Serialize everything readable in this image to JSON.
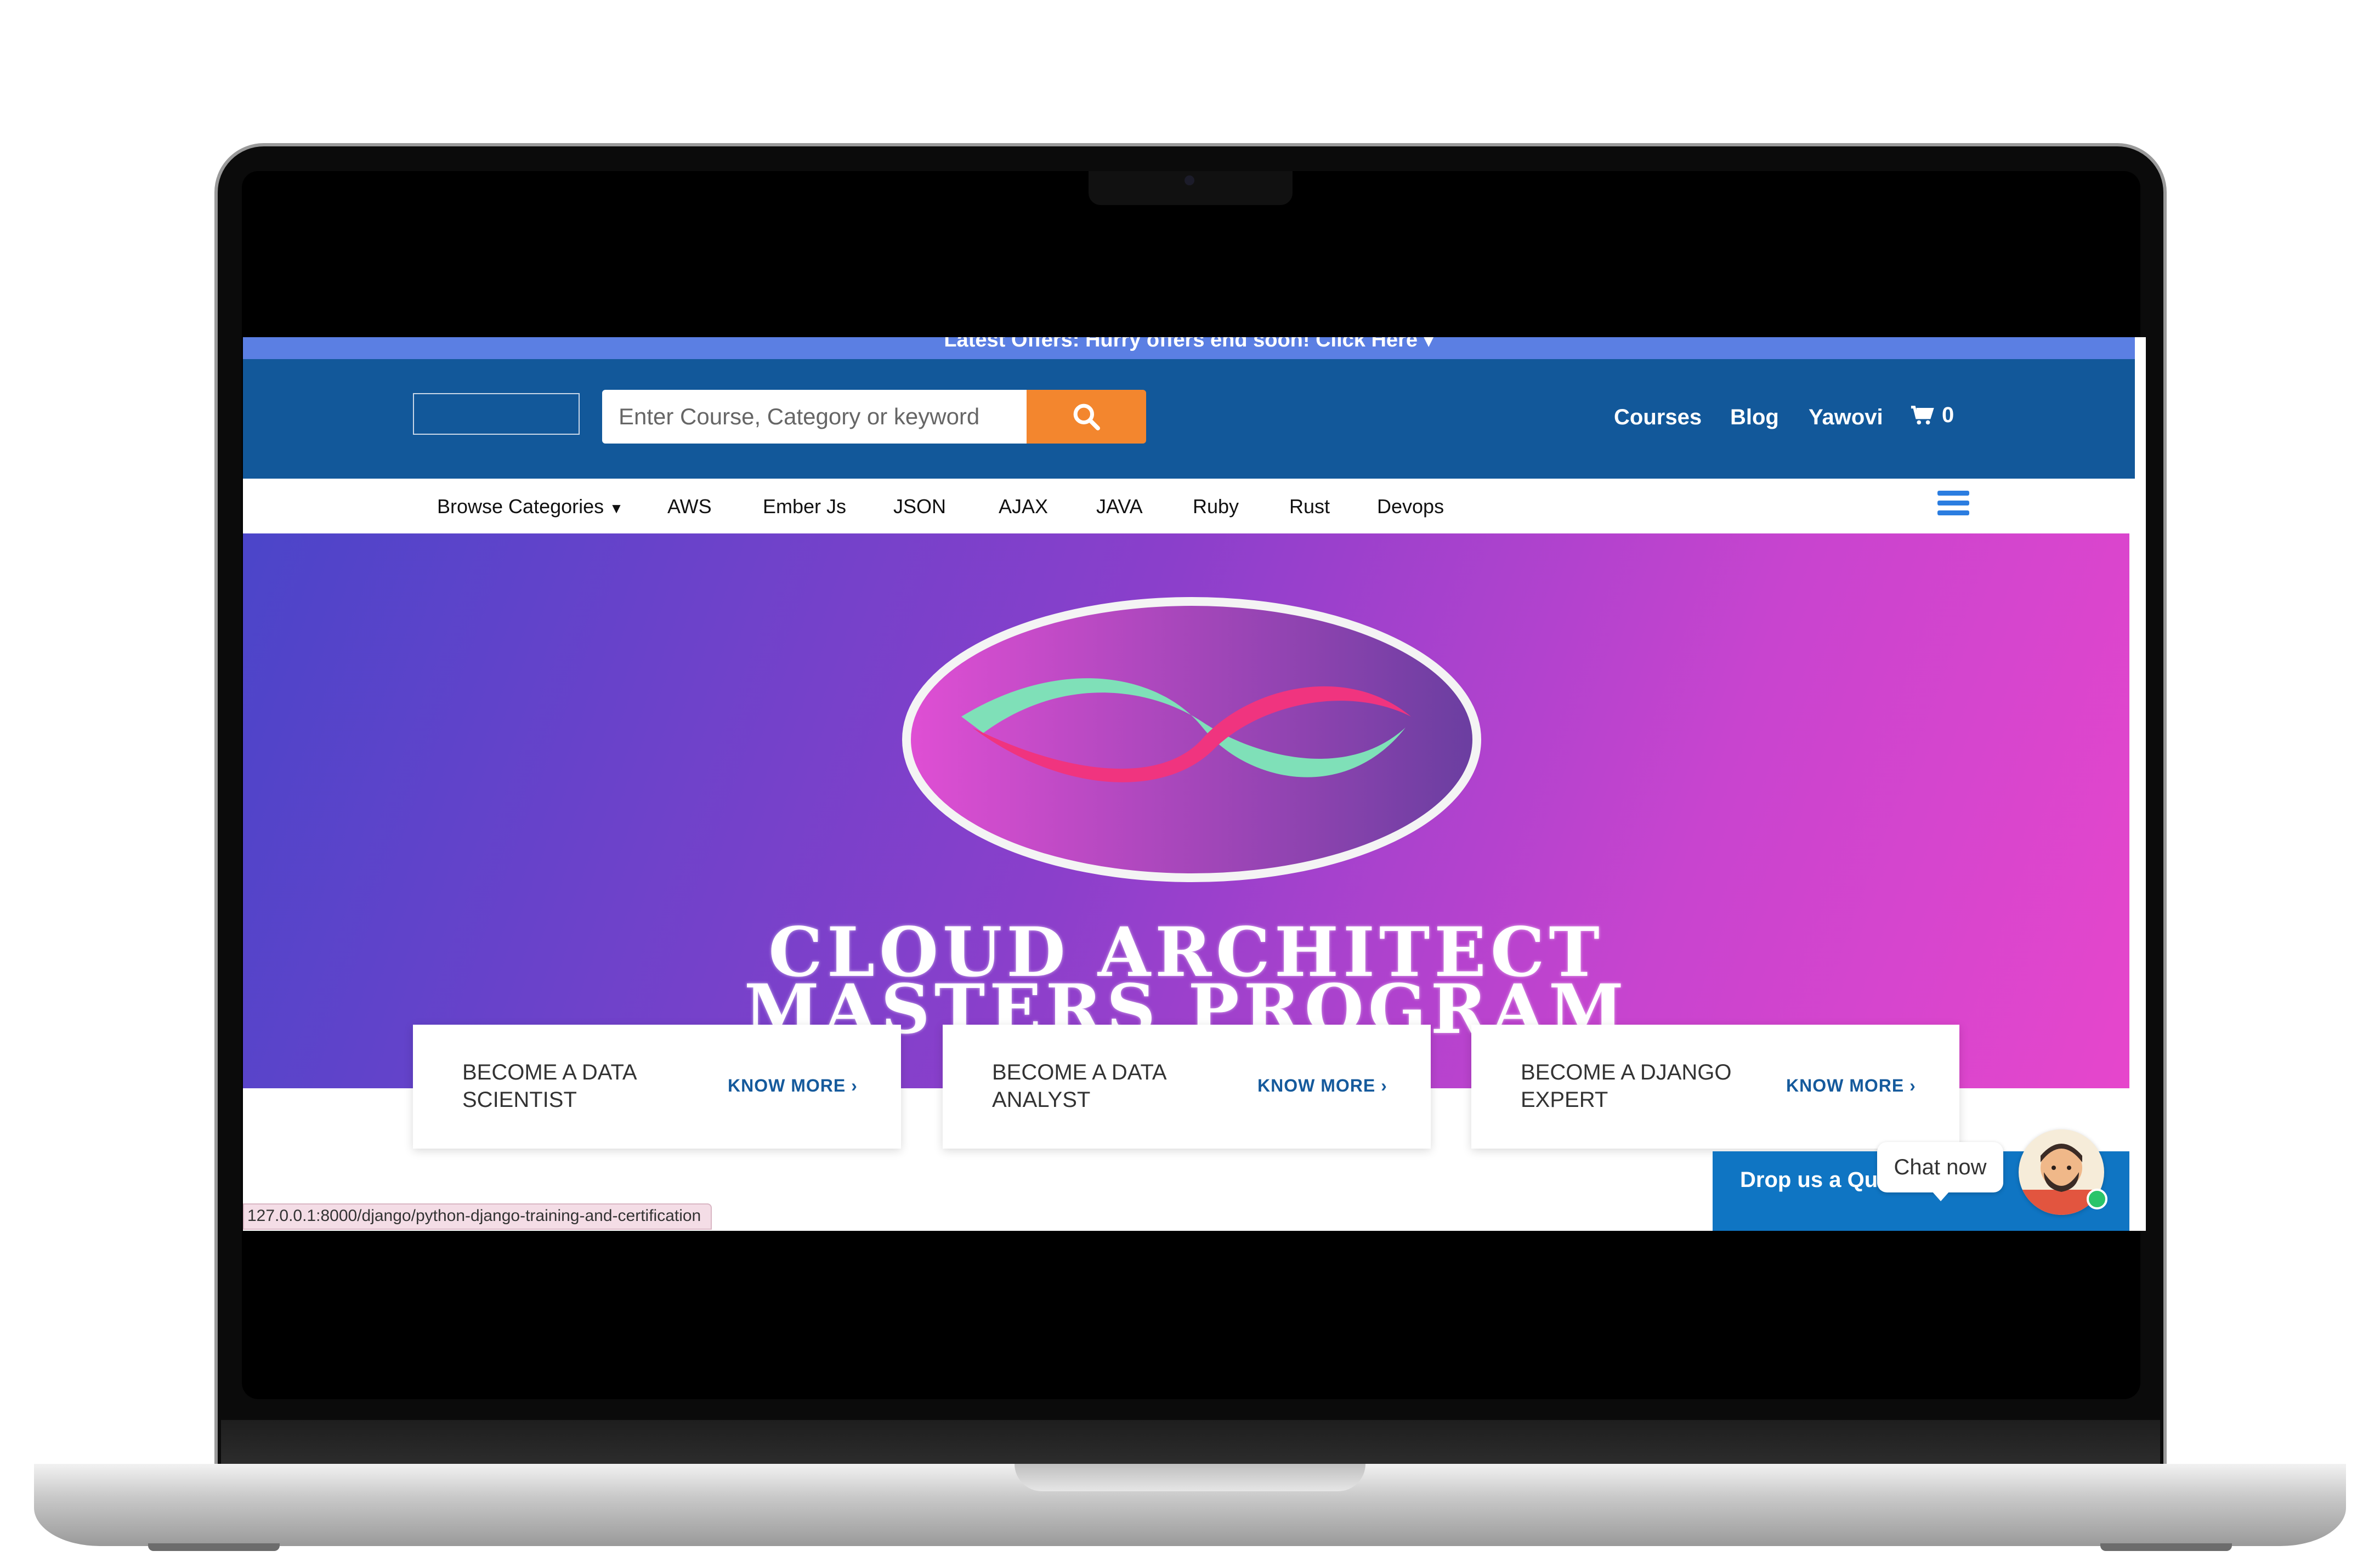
{
  "offer_bar": {
    "text": "Latest Offers: Hurry offers end soon! Click Here"
  },
  "header": {
    "search_placeholder": "Enter Course, Category or keyword",
    "nav": {
      "courses": "Courses",
      "blog": "Blog",
      "user": "Yawovi"
    },
    "cart_count": "0"
  },
  "categories": {
    "browse": "Browse Categories",
    "items": [
      "AWS",
      "Ember Js",
      "JSON",
      "AJAX",
      "JAVA",
      "Ruby",
      "Rust",
      "Devops"
    ]
  },
  "hero": {
    "line1": "CLOUD ARCHITECT",
    "line2": "MASTERS PROGRAM"
  },
  "cards": [
    {
      "title": "BECOME A DATA SCIENTIST",
      "link": "KNOW MORE"
    },
    {
      "title": "BECOME A DATA ANALYST",
      "link": "KNOW MORE"
    },
    {
      "title": "BECOME A DJANGO EXPERT",
      "link": "KNOW MORE"
    }
  ],
  "status_url": "127.0.0.1:8000/django/python-django-training-and-certification",
  "chat": {
    "drop_label": "Drop us a Qu",
    "bubble": "Chat now"
  },
  "colors": {
    "header": "#12589a",
    "offer_bar": "#5b7fe3",
    "search_button": "#f3862e",
    "link": "#155a9c",
    "chat_button": "#0f75c3"
  },
  "icons": [
    "search-icon",
    "cart-icon",
    "hamburger-icon",
    "chevron-down-icon",
    "chevron-right-icon",
    "infinity-logo",
    "avatar"
  ]
}
